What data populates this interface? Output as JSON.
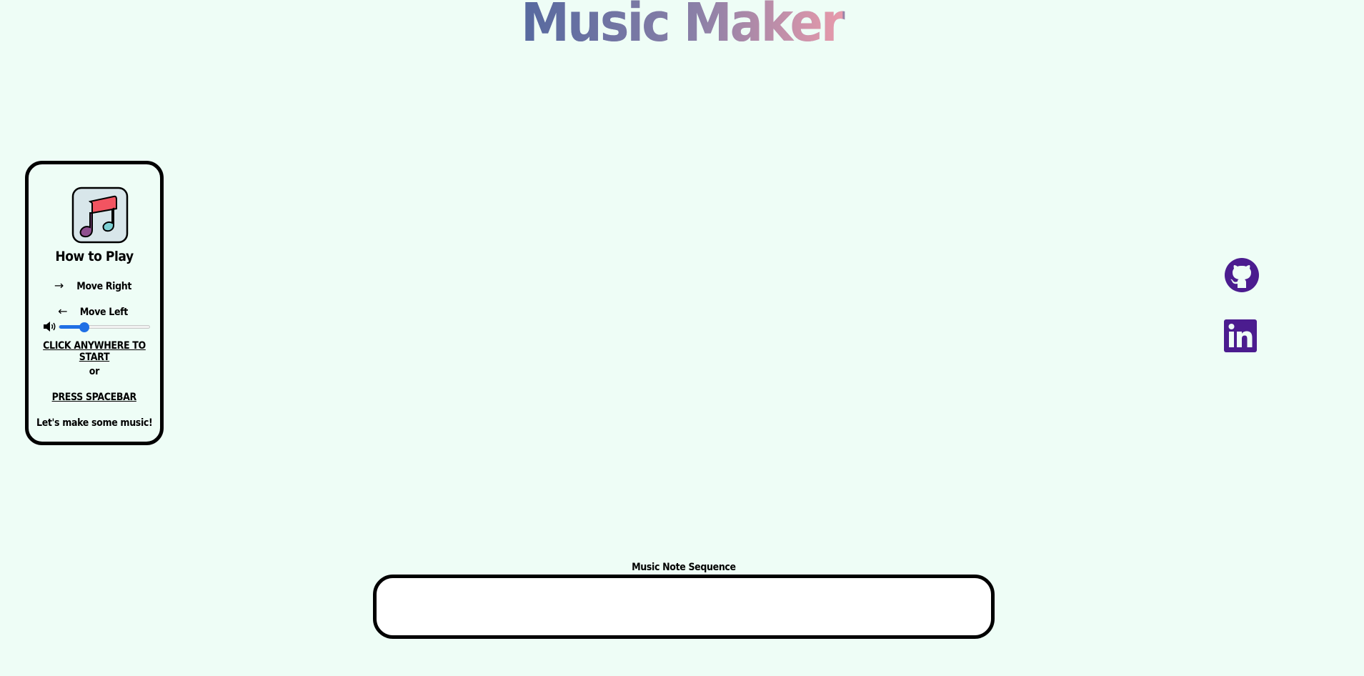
{
  "header": {
    "title": "Music Maker"
  },
  "instructions": {
    "heading": "How to Play",
    "move_right_label": "Move Right",
    "move_left_label": "Move Left",
    "volume_level": 0.28,
    "click_start_label": "CLICK ANYWHERE TO START",
    "or_label": "or",
    "spacebar_label": "PRESS SPACEBAR",
    "tagline": "Let's make some music!"
  },
  "sequence": {
    "label": "Music Note Sequence"
  },
  "icons": {
    "logo": "music-note-icon",
    "right": "arrow-right-icon",
    "left": "arrow-left-icon",
    "volume": "volume-icon",
    "github": "github-icon",
    "linkedin": "linkedin-icon"
  },
  "colors": {
    "background": "#eefdf6",
    "social": "#4b1c8f",
    "slider": "#1f6fe5",
    "note_red": "#f25461",
    "note_purple": "#8f4f8f",
    "note_teal": "#7cd0d3"
  }
}
